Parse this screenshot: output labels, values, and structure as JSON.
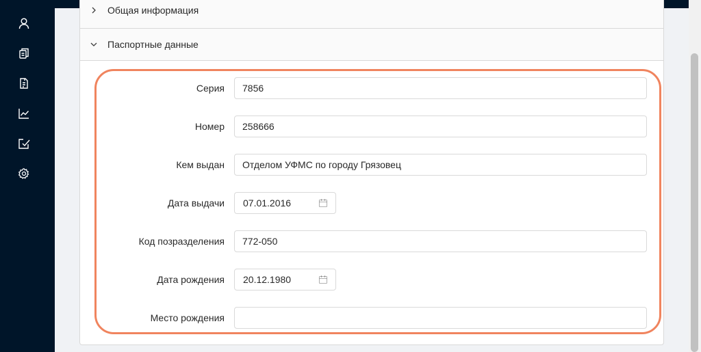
{
  "sidebar": {
    "items": [
      {
        "icon": "user-icon"
      },
      {
        "icon": "documents-icon"
      },
      {
        "icon": "file-text-icon"
      },
      {
        "icon": "line-chart-icon"
      },
      {
        "icon": "edit-check-icon"
      },
      {
        "icon": "gear-icon"
      }
    ]
  },
  "panels": {
    "general": {
      "title": "Общая информация",
      "expanded": false
    },
    "passport": {
      "title": "Паспортные данные",
      "expanded": true
    }
  },
  "form": {
    "series": {
      "label": "Серия",
      "value": "7856"
    },
    "number": {
      "label": "Номер",
      "value": "258666"
    },
    "issued_by": {
      "label": "Кем выдан",
      "value": "Отделом УФМС по городу Грязовец"
    },
    "issue_date": {
      "label": "Дата выдачи",
      "value": "07.01.2016"
    },
    "division_code": {
      "label": "Код позразделения",
      "value": "772-050"
    },
    "birth_date": {
      "label": "Дата рождения",
      "value": "20.12.1980"
    },
    "birth_place": {
      "label": "Место рождения",
      "value": ""
    }
  },
  "colors": {
    "sidebar": "#001529",
    "highlight": "#f0845e",
    "background": "#f0f2f5"
  }
}
